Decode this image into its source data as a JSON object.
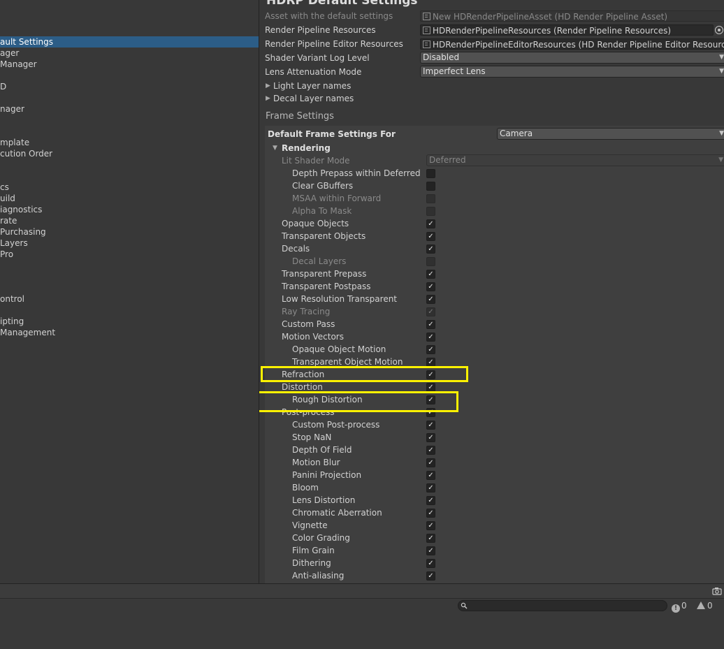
{
  "sidebar": {
    "items": [
      {
        "label": "ault Settings",
        "selected": true
      },
      {
        "label": "ager"
      },
      {
        "label": "Manager"
      },
      {
        "label": "D"
      },
      {
        "label": "nager"
      },
      {
        "label": "mplate"
      },
      {
        "label": "cution Order"
      },
      {
        "label": "cs"
      },
      {
        "label": "uild"
      },
      {
        "label": "iagnostics"
      },
      {
        "label": "rate"
      },
      {
        "label": "Purchasing"
      },
      {
        "label": "Layers"
      },
      {
        "label": "Pro"
      },
      {
        "label": "ontrol"
      },
      {
        "label": "ipting"
      },
      {
        "label": "Management"
      }
    ]
  },
  "header": {
    "title": "HDRP Default Settings"
  },
  "asset": {
    "label": "Asset with the default settings",
    "value": "New HDRenderPipelineAsset (HD Render Pipeline Asset)"
  },
  "resources": {
    "label": "Render Pipeline Resources",
    "value": "HDRenderPipelineResources (Render Pipeline Resources)"
  },
  "editor_resources": {
    "label": "Render Pipeline Editor Resources",
    "value": "HDRenderPipelineEditorResources (HD Render Pipeline Editor Resources)"
  },
  "shader_log": {
    "label": "Shader Variant Log Level",
    "value": "Disabled"
  },
  "lens": {
    "label": "Lens Attenuation Mode",
    "value": "Imperfect Lens"
  },
  "light_layers": {
    "label": "Light Layer names"
  },
  "decal_layers": {
    "label": "Decal Layer names"
  },
  "frame_settings": {
    "title": "Frame Settings",
    "default_for_label": "Default Frame Settings For",
    "default_for_value": "Camera",
    "rendering_label": "Rendering",
    "lit_shader_mode": {
      "label": "Lit Shader Mode",
      "value": "Deferred"
    }
  },
  "rows": [
    {
      "label": "Depth Prepass within Deferred",
      "indent": 2,
      "checked": false,
      "disabled": false,
      "dim": false
    },
    {
      "label": "Clear GBuffers",
      "indent": 2,
      "checked": false,
      "disabled": false,
      "dim": false
    },
    {
      "label": "MSAA within Forward",
      "indent": 2,
      "checked": false,
      "disabled": true,
      "dim": true
    },
    {
      "label": "Alpha To Mask",
      "indent": 2,
      "checked": false,
      "disabled": true,
      "dim": true
    },
    {
      "label": "Opaque Objects",
      "indent": 1,
      "checked": true,
      "disabled": false,
      "dim": false
    },
    {
      "label": "Transparent Objects",
      "indent": 1,
      "checked": true,
      "disabled": false,
      "dim": false
    },
    {
      "label": "Decals",
      "indent": 1,
      "checked": true,
      "disabled": false,
      "dim": false
    },
    {
      "label": "Decal Layers",
      "indent": 2,
      "checked": false,
      "disabled": true,
      "dim": true
    },
    {
      "label": "Transparent Prepass",
      "indent": 1,
      "checked": true,
      "disabled": false,
      "dim": false
    },
    {
      "label": "Transparent Postpass",
      "indent": 1,
      "checked": true,
      "disabled": false,
      "dim": false
    },
    {
      "label": "Low Resolution Transparent",
      "indent": 1,
      "checked": true,
      "disabled": false,
      "dim": false
    },
    {
      "label": "Ray Tracing",
      "indent": 1,
      "checked": true,
      "disabled": true,
      "dim": true
    },
    {
      "label": "Custom Pass",
      "indent": 1,
      "checked": true,
      "disabled": false,
      "dim": false
    },
    {
      "label": "Motion Vectors",
      "indent": 1,
      "checked": true,
      "disabled": false,
      "dim": false
    },
    {
      "label": "Opaque Object Motion",
      "indent": 2,
      "checked": true,
      "disabled": false,
      "dim": false
    },
    {
      "label": "Transparent Object Motion",
      "indent": 2,
      "checked": true,
      "disabled": false,
      "dim": false
    },
    {
      "label": "Refraction",
      "indent": 1,
      "checked": true,
      "disabled": false,
      "dim": false
    },
    {
      "label": "Distortion",
      "indent": 1,
      "checked": true,
      "disabled": false,
      "dim": false
    },
    {
      "label": "Rough Distortion",
      "indent": 2,
      "checked": true,
      "disabled": false,
      "dim": false
    },
    {
      "label": "Post-process",
      "indent": 1,
      "checked": true,
      "disabled": false,
      "dim": false
    },
    {
      "label": "Custom Post-process",
      "indent": 2,
      "checked": true,
      "disabled": false,
      "dim": false
    },
    {
      "label": "Stop NaN",
      "indent": 2,
      "checked": true,
      "disabled": false,
      "dim": false
    },
    {
      "label": "Depth Of Field",
      "indent": 2,
      "checked": true,
      "disabled": false,
      "dim": false
    },
    {
      "label": "Motion Blur",
      "indent": 2,
      "checked": true,
      "disabled": false,
      "dim": false
    },
    {
      "label": "Panini Projection",
      "indent": 2,
      "checked": true,
      "disabled": false,
      "dim": false
    },
    {
      "label": "Bloom",
      "indent": 2,
      "checked": true,
      "disabled": false,
      "dim": false
    },
    {
      "label": "Lens Distortion",
      "indent": 2,
      "checked": true,
      "disabled": false,
      "dim": false
    },
    {
      "label": "Chromatic Aberration",
      "indent": 2,
      "checked": true,
      "disabled": false,
      "dim": false
    },
    {
      "label": "Vignette",
      "indent": 2,
      "checked": true,
      "disabled": false,
      "dim": false
    },
    {
      "label": "Color Grading",
      "indent": 2,
      "checked": true,
      "disabled": false,
      "dim": false
    },
    {
      "label": "Film Grain",
      "indent": 2,
      "checked": true,
      "disabled": false,
      "dim": false
    },
    {
      "label": "Dithering",
      "indent": 2,
      "checked": true,
      "disabled": false,
      "dim": false
    },
    {
      "label": "Anti-aliasing",
      "indent": 2,
      "checked": true,
      "disabled": false,
      "dim": false
    }
  ],
  "console": {
    "errors": "0",
    "warnings": "0"
  },
  "icons": {
    "camera": "camera-icon",
    "search": "search-icon",
    "error": "error-icon",
    "warning": "warning-icon"
  },
  "colors": {
    "selection": "#2c5d87",
    "highlight": "#fff200",
    "background": "#383838"
  }
}
